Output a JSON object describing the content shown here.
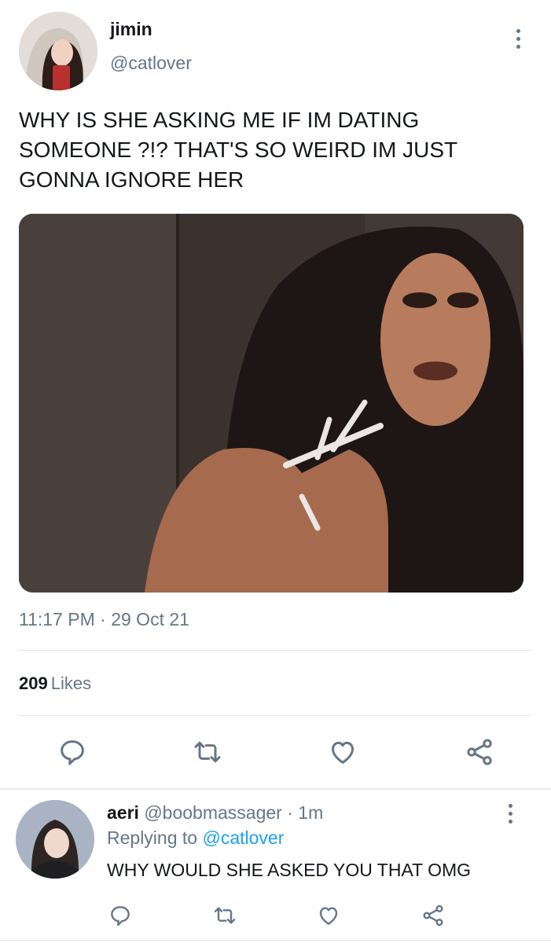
{
  "tweet": {
    "author_name": "jimin",
    "author_handle": "@catlover",
    "text": "WHY IS SHE ASKING ME IF IM DATING\nSOMEONE ?!? THAT'S SO WEIRD IM JUST\nGONNA IGNORE HER",
    "time": "11:17 PM",
    "separator": "·",
    "date": "29 Oct 21",
    "likes_count": "209",
    "likes_label": "Likes",
    "actions": [
      "reply-icon",
      "retweet-icon",
      "like-icon",
      "share-icon"
    ]
  },
  "reply": {
    "author_name": "aeri",
    "author_handle": "@boobmassager",
    "separator": "·",
    "age": "1m",
    "replying_prefix": "Replying to",
    "replying_handle": "@catlover",
    "text": "WHY WOULD SHE ASKED YOU THAT OMG",
    "actions": [
      "reply-icon",
      "retweet-icon",
      "like-icon",
      "share-icon"
    ]
  },
  "colors": {
    "text_primary": "#14171a",
    "text_secondary": "#657786",
    "link": "#1da1f2",
    "divider": "#e1e8ed"
  }
}
